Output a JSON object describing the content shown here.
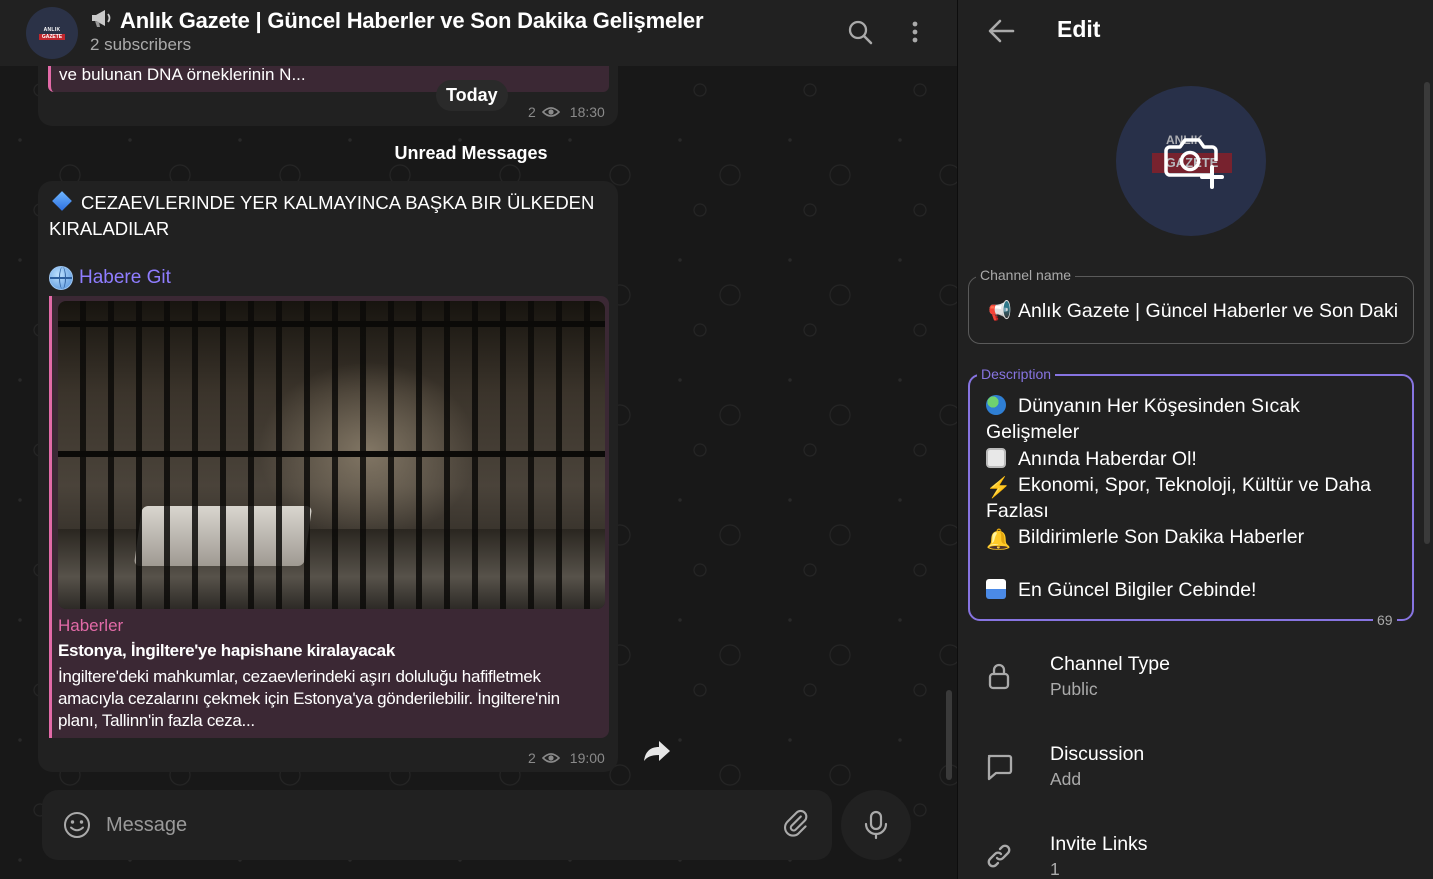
{
  "colors": {
    "accent": "#8774e1",
    "source_pink": "#e26aa7",
    "bg_panel": "#212121",
    "bg_chat": "#181818"
  },
  "header": {
    "channel_title": "Anlık Gazete | Güncel Haberler ve Son Dakika Gelişmeler",
    "subscribers": "2 subscribers",
    "avatar_line1": "ANLIK",
    "avatar_line2": "GAZETE",
    "search_icon": "search-icon",
    "more_icon": "more-vertical-icon"
  },
  "chat": {
    "prev_message_excerpt": "ve bulunan DNA örneklerinin N...",
    "date_pill": "Today",
    "prev_views": "2",
    "prev_time": "18:30",
    "unread_label": "Unread Messages",
    "post": {
      "title": "CEZAEVLERINDE YER KALMAYINCA BAŞKA BIR ÜLKEDEN KIRALADILAR",
      "link_label": "Habere Git",
      "source_name": "Haberler",
      "headline": "Estonya, İngiltere'ye hapishane kiralayacak",
      "summary": "İngiltere'deki mahkumlar, cezaevlerindeki aşırı doluluğu hafifletmek amacıyla cezalarını çekmek için Estonya'ya gönderilebilir. İngiltere'nin planı, Tallinn'in fazla ceza...",
      "views": "2",
      "time": "19:00"
    },
    "composer_placeholder": "Message"
  },
  "edit": {
    "title": "Edit",
    "avatar_tag_top": "ANLIK",
    "avatar_tag": "GAZETE",
    "channel_name_label": "Channel name",
    "channel_name_value": "Anlık Gazete | Güncel Haberler ve Son Daki",
    "description_label": "Description",
    "description_lines": {
      "l1": "Dünyanın Her Köşesinden Sıcak",
      "l1b": "Gelişmeler",
      "l2": "Anında Haberdar Ol!",
      "l3": "Ekonomi, Spor, Teknoloji, Kültür ve Daha",
      "l3b": "Fazlası",
      "l4": "Bildirimlerle Son Dakika Haberler",
      "l5": "En Güncel Bilgiler Cebinde!"
    },
    "description_remaining": "69",
    "settings": [
      {
        "name": "Channel Type",
        "value": "Public",
        "icon": "lock-icon"
      },
      {
        "name": "Discussion",
        "value": "Add",
        "icon": "chat-bubble-icon"
      },
      {
        "name": "Invite Links",
        "value": "1",
        "icon": "link-icon"
      }
    ]
  }
}
